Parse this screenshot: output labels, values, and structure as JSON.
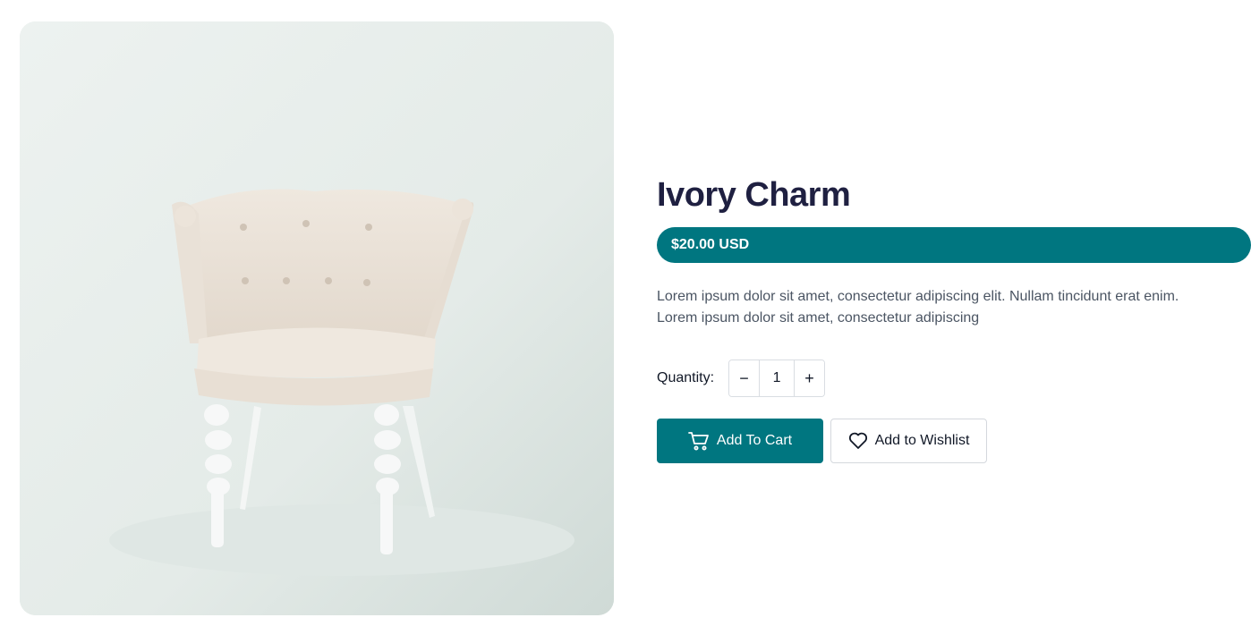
{
  "product": {
    "image_alt": "White tufted armchair",
    "title": "Ivory Charm",
    "price": "$20.00 USD",
    "description_line1": "Lorem ipsum dolor sit amet, consectetur adipiscing elit. Nullam tincidunt erat enim.",
    "description_line2": "Lorem ipsum dolor sit amet, consectetur adipiscing"
  },
  "quantity": {
    "label": "Quantity:",
    "value": "1",
    "decrement": "−",
    "increment": "+"
  },
  "actions": {
    "add_to_cart": "Add To Cart",
    "add_to_wishlist": "Add to Wishlist",
    "cart_icon": "cart-icon",
    "wishlist_icon": "heart-icon"
  },
  "colors": {
    "accent": "#007680",
    "title": "#1f2041",
    "body_text": "#4b5563"
  }
}
